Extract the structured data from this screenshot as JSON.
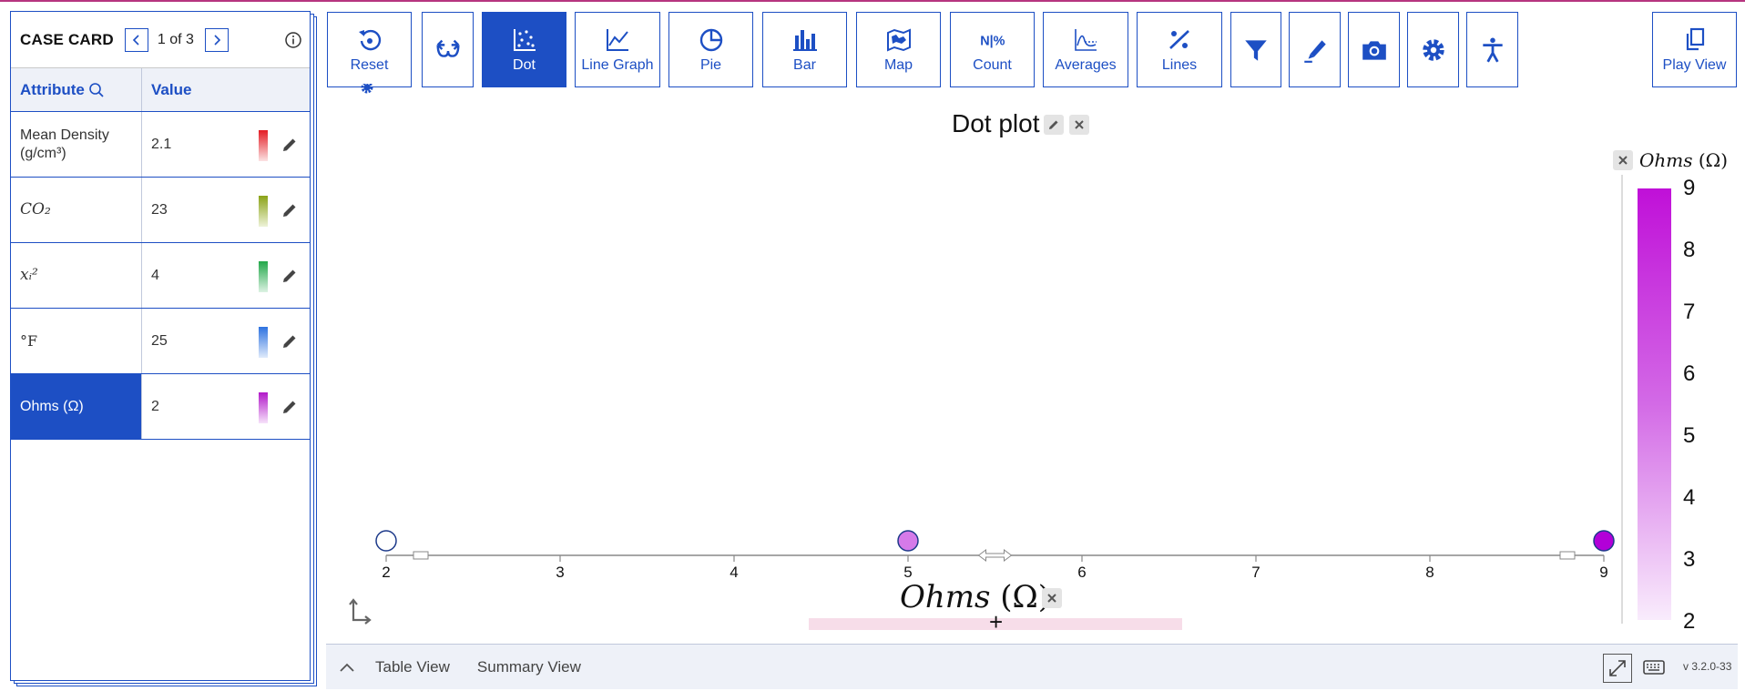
{
  "case_card": {
    "title": "CASE CARD",
    "count": "1 of 3",
    "columns": {
      "attribute": "Attribute",
      "value": "Value"
    },
    "rows": [
      {
        "attribute": "Mean Density (g/cm³)",
        "value": "2.1",
        "color": "#e41c24"
      },
      {
        "attribute": "CO₂",
        "value": "23",
        "color": "#8ba317"
      },
      {
        "attribute": "xᵢ²",
        "value": "4",
        "color": "#23a84a"
      },
      {
        "attribute": "°F",
        "value": "25",
        "color": "#2e73e0"
      },
      {
        "attribute": "Ohms (Ω)",
        "value": "2",
        "color": "#b219c9"
      }
    ]
  },
  "toolbar": {
    "reset": "Reset",
    "dot": "Dot",
    "line_graph": "Line Graph",
    "pie": "Pie",
    "bar": "Bar",
    "map": "Map",
    "count": "Count",
    "averages": "Averages",
    "lines": "Lines",
    "play_view": "Play View"
  },
  "graph": {
    "title": "Dot plot",
    "axis_attr": "Ohms",
    "axis_unit": "(Ω)",
    "legend_attr": "Ohms",
    "legend_unit": "(Ω)",
    "legend_ticks": [
      "9",
      "8",
      "7",
      "6",
      "5",
      "4",
      "3",
      "2"
    ]
  },
  "chart_data": {
    "type": "scatter",
    "title": "Dot plot",
    "xlabel": "Ohms (Ω)",
    "xlim": [
      2,
      9
    ],
    "ticks": [
      2,
      3,
      4,
      5,
      6,
      7,
      8,
      9
    ],
    "points": [
      {
        "x": 2,
        "color": "#ffffff"
      },
      {
        "x": 5,
        "color": "#d57ae9"
      },
      {
        "x": 9,
        "color": "#b200d8"
      }
    ],
    "legend": {
      "attribute": "Ohms (Ω)",
      "range": [
        2,
        9
      ],
      "color_low": "#f9ecfc",
      "color_high": "#c010d8"
    }
  },
  "bottom": {
    "table_view": "Table View",
    "summary_view": "Summary View",
    "version": "v 3.2.0-33"
  }
}
